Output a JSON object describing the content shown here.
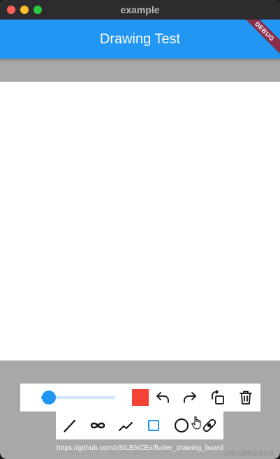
{
  "window": {
    "title": "example"
  },
  "appbar": {
    "title": "Drawing Test",
    "debug_label": "DEBUG",
    "color": "#2196f3"
  },
  "toolbar": {
    "stroke_slider": {
      "value": 0.1
    },
    "color": "#f44336",
    "actions": [
      {
        "name": "undo-icon"
      },
      {
        "name": "redo-icon"
      },
      {
        "name": "rotate-icon"
      },
      {
        "name": "trash-icon"
      }
    ],
    "tools": [
      {
        "name": "pen-icon"
      },
      {
        "name": "infinity-icon"
      },
      {
        "name": "straight-line-icon"
      },
      {
        "name": "rectangle-icon",
        "selected": true
      },
      {
        "name": "circle-icon"
      },
      {
        "name": "eraser-icon"
      }
    ]
  },
  "footer": {
    "link": "https://github.com/xSILENCEx/flutter_drawing_board",
    "watermark": "@稀土掘金技术社区"
  }
}
